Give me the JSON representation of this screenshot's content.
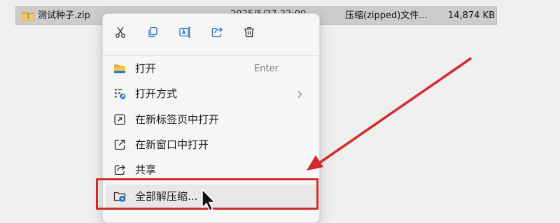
{
  "file": {
    "name": "测试种子.zip",
    "date": "2025/5/27 22:00",
    "type": "压缩(zipped)文件...",
    "size": "14,874 KB"
  },
  "quick_actions": [
    {
      "name": "cut",
      "icon": "scissors-icon"
    },
    {
      "name": "copy",
      "icon": "copy-icon"
    },
    {
      "name": "rename",
      "icon": "rename-icon"
    },
    {
      "name": "share",
      "icon": "share-icon"
    },
    {
      "name": "delete",
      "icon": "trash-icon"
    }
  ],
  "menu_items": [
    {
      "label": "打开",
      "shortcut": "Enter",
      "icon": "folder-icon"
    },
    {
      "label": "打开方式",
      "icon": "open-with-icon",
      "has_submenu": true
    },
    {
      "label": "在新标签页中打开",
      "icon": "open-new-tab-icon"
    },
    {
      "label": "在新窗口中打开",
      "icon": "open-new-window-icon"
    },
    {
      "label": "共享",
      "icon": "share-icon"
    },
    {
      "label": "全部解压缩...",
      "icon": "extract-all-icon",
      "highlighted": true
    }
  ],
  "colors": {
    "annotation_red": "#d42a2a",
    "menu_background": "#f6f6f6",
    "selected_row": "#cccccc",
    "accent_blue": "#1f6fc5"
  }
}
